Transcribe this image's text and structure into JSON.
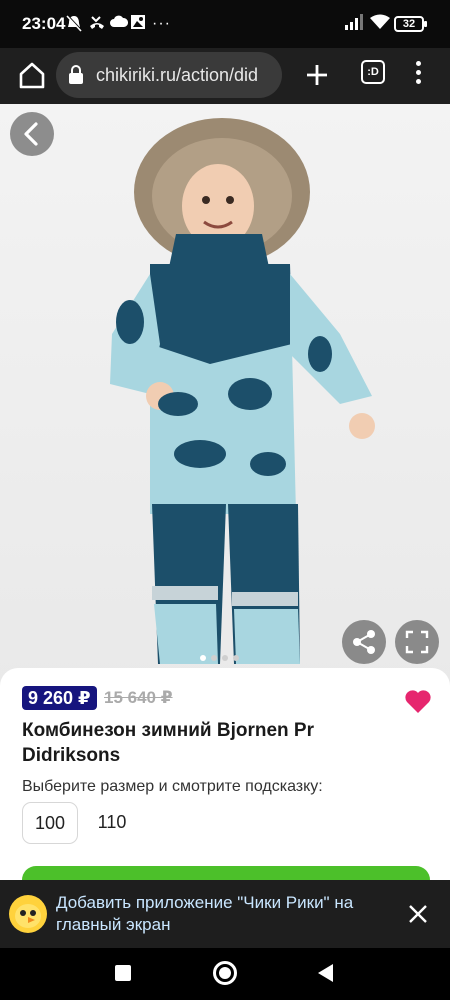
{
  "status_bar": {
    "time": "23:04",
    "battery": "32"
  },
  "browser": {
    "url": "chikiriki.ru/action/did",
    "tabs_label": ":D"
  },
  "gallery": {
    "slide_count": 4,
    "active_slide": 1
  },
  "product": {
    "price_new": "9 260 ₽",
    "price_old": "15 640 ₽",
    "title": "Комбинезон зимний Bjornen Pr Didriksons",
    "size_hint": "Выберите размер и смотрите подсказку:",
    "sizes": [
      "100",
      "110"
    ],
    "selected_size": "100"
  },
  "banner": {
    "text": "Добавить приложение \"Чики Рики\" на главный экран"
  },
  "colors": {
    "price_badge": "#16157e",
    "favorite": "#e6266e",
    "add_button": "#4cc02a",
    "banner_text": "#c9e6ff"
  }
}
